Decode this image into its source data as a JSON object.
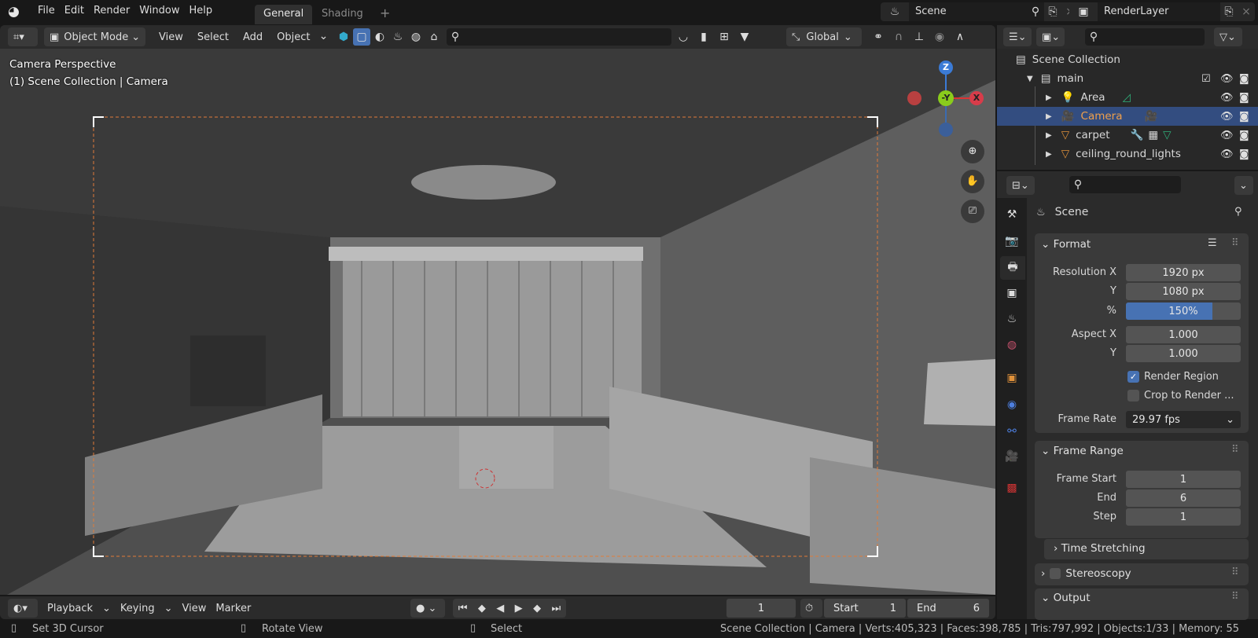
{
  "topbar": {
    "menu": [
      "File",
      "Edit",
      "Render",
      "Window",
      "Help"
    ],
    "workspace_tabs": [
      "General",
      "Shading"
    ],
    "add_tab": "+",
    "scene": "Scene",
    "render_layer": "RenderLayer"
  },
  "viewport_header": {
    "mode": "Object Mode",
    "menus": [
      "View",
      "Select",
      "Add",
      "Object"
    ],
    "transform_orientation": "Global"
  },
  "viewport": {
    "overlay_line1": "Camera Perspective",
    "overlay_line2": "(1) Scene Collection | Camera",
    "gizmo": {
      "z": "Z",
      "y": "-Y",
      "x": "X"
    },
    "frame_color": "#e07b39"
  },
  "outliner": {
    "root": "Scene Collection",
    "collection": "main",
    "items": [
      {
        "name": "Area",
        "icon": "light-icon"
      },
      {
        "name": "Camera",
        "icon": "camera-icon",
        "selected": true
      },
      {
        "name": "carpet",
        "icon": "mesh-icon"
      },
      {
        "name": "ceiling_round_lights",
        "icon": "mesh-icon"
      }
    ]
  },
  "properties": {
    "context": "Scene",
    "format": {
      "title": "Format",
      "resolution_x_label": "Resolution X",
      "resolution_x": "1920 px",
      "y_label": "Y",
      "resolution_y": "1080 px",
      "percent_label": "%",
      "percent": "150%",
      "percent_fill": 0.75,
      "aspect_x_label": "Aspect X",
      "aspect_x": "1.000",
      "aspect_y_label": "Y",
      "aspect_y": "1.000",
      "render_region": "Render Region",
      "render_region_checked": true,
      "crop": "Crop to Render ...",
      "crop_checked": false,
      "frame_rate_label": "Frame Rate",
      "frame_rate": "29.97 fps"
    },
    "frame_range": {
      "title": "Frame Range",
      "start_label": "Frame Start",
      "start": "1",
      "end_label": "End",
      "end": "6",
      "step_label": "Step",
      "step": "1"
    },
    "time_stretching": "Time Stretching",
    "stereoscopy": "Stereoscopy",
    "output": "Output"
  },
  "timeline": {
    "menus": [
      "Playback",
      "Keying",
      "View",
      "Marker"
    ],
    "current_frame": "1",
    "start_label": "Start",
    "start": "1",
    "end_label": "End",
    "end": "6"
  },
  "statusbar": {
    "hints": [
      "Set 3D Cursor",
      "Rotate View",
      "Select"
    ],
    "stats": "Scene Collection | Camera | Verts:405,323 | Faces:398,785 | Tris:797,992 | Objects:1/33 | Memory: 55"
  },
  "colors": {
    "accent": "#4772b3",
    "selected_row": "#334d80",
    "active_text": "#f0a04b"
  }
}
